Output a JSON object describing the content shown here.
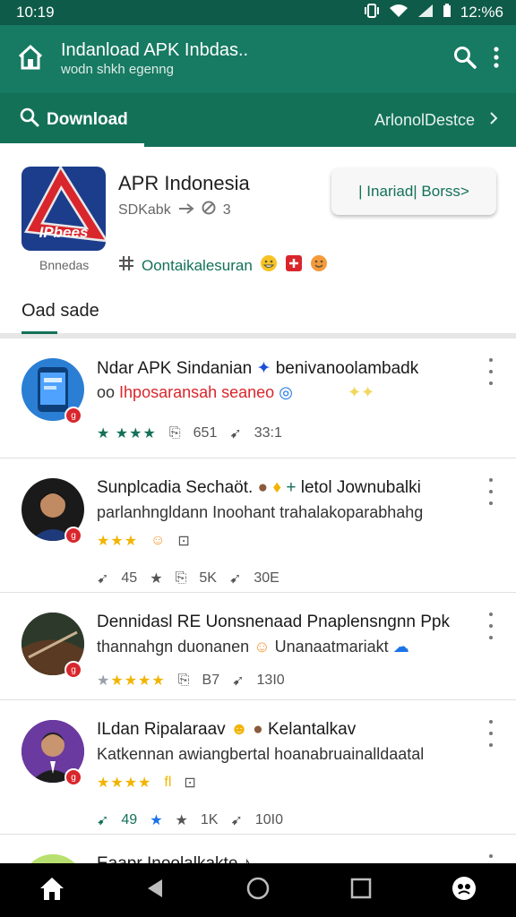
{
  "status_bar": {
    "time": "10:19",
    "battery": "12:%6"
  },
  "app_bar": {
    "title": "Indanload APK Inbdas..",
    "subtitle": "wodn shkh egenng"
  },
  "tabs": {
    "active_label": "Download",
    "right_label": "ArlonolDestce"
  },
  "app": {
    "name": "APR Indonesia",
    "meta_text": "SDKabk",
    "meta_num": "3",
    "logo_text": "IPbees",
    "logo_caption": "Bnnedas",
    "install_label": "| Inariad|  Borss>",
    "developer_label": "Oontaikalesuran"
  },
  "section": {
    "title": "Oad sade"
  },
  "items": [
    {
      "title": "Ndar APK Sindanian",
      "title_extra": "benivanoolambadk",
      "sub_prefix": "oo",
      "sub": "Ihposaransah seaneo",
      "stat1": "651",
      "stat2": "33:1",
      "badge": "g"
    },
    {
      "title": "Sunplcadia Sechaöt.",
      "title_extra": "letol Jownubalki",
      "sub": "parlanhngldann Inoohant trahalakoparabhahg",
      "stat1": "45",
      "stat2": "5K",
      "stat3": "30E",
      "badge": "g"
    },
    {
      "title": "Dennidasl RE Uonsnenaad Pnaplensngnn Ppk",
      "sub": "thannahgn duonanen",
      "sub_extra": "Unanaatmariakt",
      "stat1": "B7",
      "stat2": "13I0",
      "badge": "g"
    },
    {
      "title": "ILdan Ripalaraav",
      "title_extra": "Kelantalkav",
      "sub": "Katkennan awiangbertal hoanabruainalldaatal",
      "stars_suffix": "fl",
      "stat1": "49",
      "stat2": "1K",
      "stat3": "10I0",
      "badge": "g"
    },
    {
      "title": "Eaapr Inoolalkakte"
    }
  ]
}
